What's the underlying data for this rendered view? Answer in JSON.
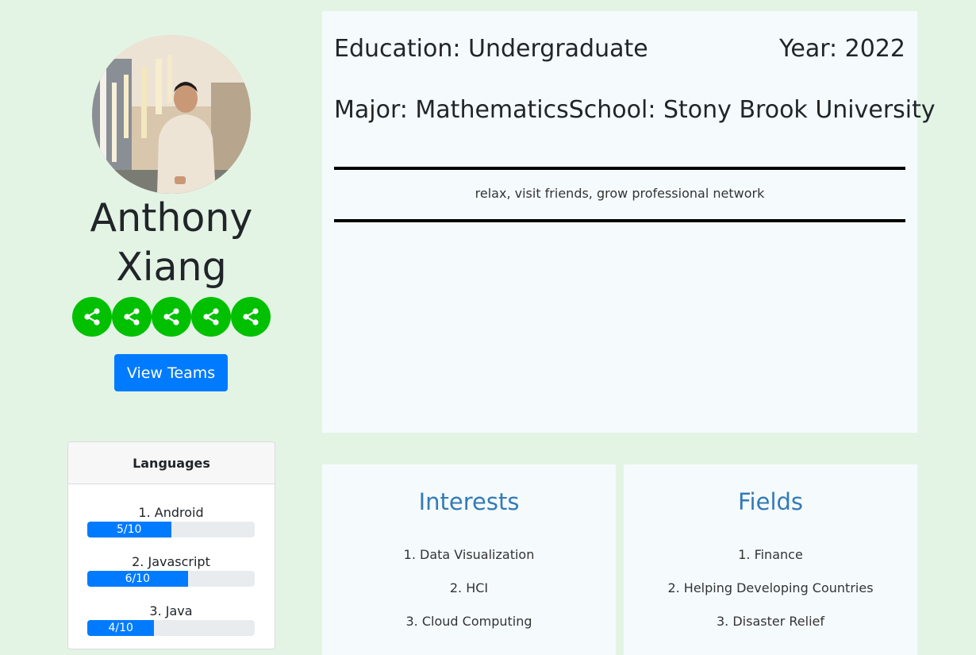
{
  "profile": {
    "name_line1": "Anthony",
    "name_line2": "Xiang",
    "avatar_icon": "profile-photo"
  },
  "socials": [
    {
      "icon": "share-icon"
    },
    {
      "icon": "share-icon"
    },
    {
      "icon": "share-icon"
    },
    {
      "icon": "share-icon"
    },
    {
      "icon": "share-icon"
    }
  ],
  "actions": {
    "view_teams": "View Teams"
  },
  "languages": {
    "title": "Languages",
    "items": [
      {
        "label": "1. Android",
        "rating": "5/10",
        "value": 5,
        "max": 10
      },
      {
        "label": "2. Javascript",
        "rating": "6/10",
        "value": 6,
        "max": 10
      },
      {
        "label": "3. Java",
        "rating": "4/10",
        "value": 4,
        "max": 10
      }
    ]
  },
  "info": {
    "education": "Education: Undergraduate",
    "year": "Year: 2022",
    "major": "Major: Mathematics",
    "school": "School: Stony Brook University",
    "motto": "relax, visit friends, grow professional network"
  },
  "interests": {
    "title": "Interests",
    "items": [
      "1. Data Visualization",
      "2. HCI",
      "3. Cloud Computing"
    ]
  },
  "fields": {
    "title": "Fields",
    "items": [
      "1. Finance",
      "2. Helping Developing Countries",
      "3. Disaster Relief"
    ]
  },
  "colors": {
    "background": "#e3f4e5",
    "card": "#f5fbfd",
    "social_green": "#00c000",
    "primary_blue": "#007bff",
    "heading_blue": "#337ab7"
  }
}
